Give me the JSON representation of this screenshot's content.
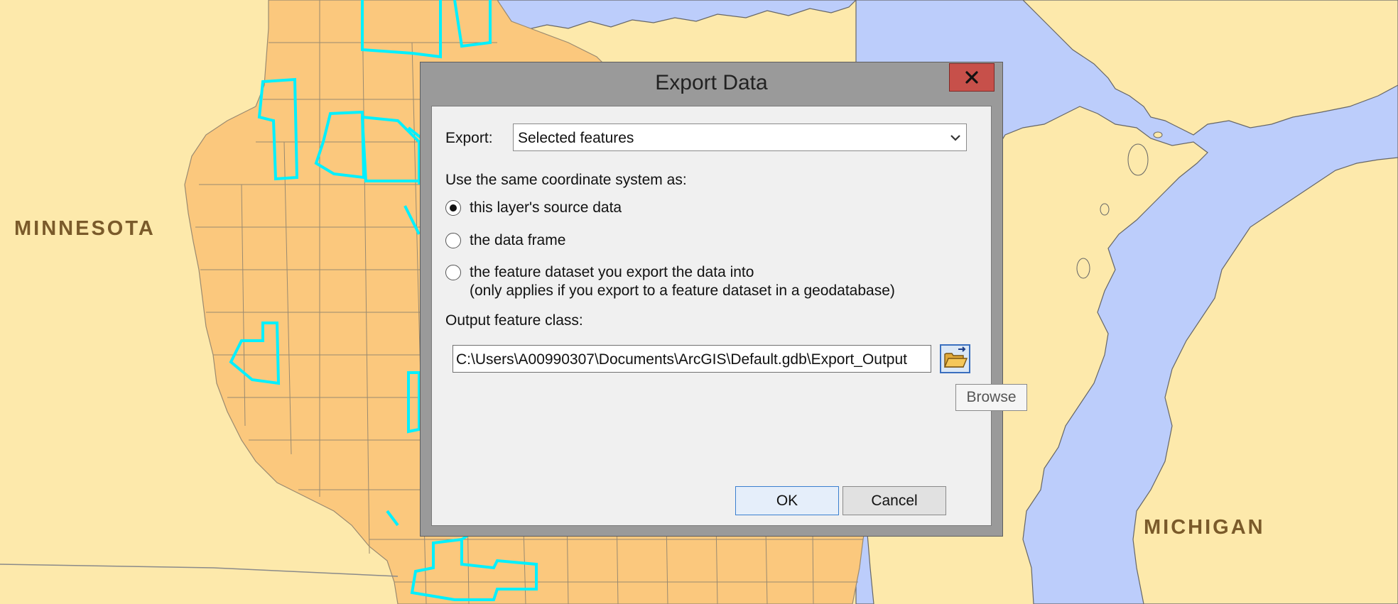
{
  "map": {
    "labels": {
      "minnesota": "MINNESOTA",
      "michigan": "MICHIGAN"
    },
    "colors": {
      "land": "#fde9ab",
      "counties": "#fbc87d",
      "water": "#bccdfb",
      "selection": "#00f0ff"
    }
  },
  "dialog": {
    "title": "Export Data",
    "close_icon": "close-x-icon",
    "export_label": "Export:",
    "export_value": "Selected features",
    "coord_heading": "Use the same coordinate system as:",
    "radio_options": [
      {
        "label": "this layer's source data",
        "selected": true
      },
      {
        "label": "the data frame",
        "selected": false
      },
      {
        "label": "the feature dataset you export the data into",
        "note": "(only applies if you export to a feature dataset in a geodatabase)",
        "selected": false
      }
    ],
    "output_label": "Output feature class:",
    "output_path": "C:\\Users\\A00990307\\Documents\\ArcGIS\\Default.gdb\\Export_Output",
    "browse_icon": "open-folder-icon",
    "browse_tooltip": "Browse",
    "ok_label": "OK",
    "cancel_label": "Cancel"
  }
}
